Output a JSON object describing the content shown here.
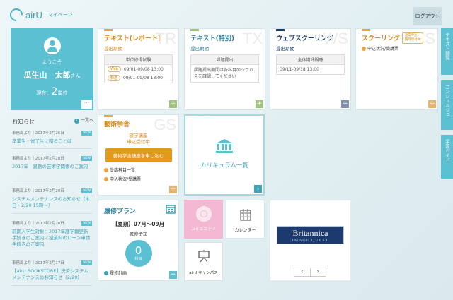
{
  "header": {
    "logo_text": "airU",
    "logo_sub": "マイページ",
    "logout": "ログアウト"
  },
  "profile": {
    "welcome": "ようこそ",
    "name": "瓜生山　太郎",
    "honorific": "さん",
    "credits_prefix": "現在：",
    "credits_value": "2",
    "credits_unit": "単位",
    "more": "···"
  },
  "news": {
    "heading": "お知らせ",
    "all_link": "一覧へ",
    "new_badge": "NEW",
    "items": [
      {
        "meta": "事務局より｜2017年2月25日",
        "title": "卒業生・修了生に贈ることば"
      },
      {
        "meta": "事務局より｜2017年2月20日",
        "title": "2017年　異動の芸術学関係のご案内"
      },
      {
        "meta": "事務局より｜2017年2月20日",
        "title": "システムメンテナンスのお知らせ（木日・2/20 15時～）"
      },
      {
        "meta": "事務局より｜2017年2月20日",
        "title": "前期入学生対象：2017年度学籍更新手続きのご案内／授業料のローン申請手続きのご案内"
      },
      {
        "meta": "事務局より｜2017年2月17日",
        "title": "【airU BOOKSTORE】決済システムメンテナンスのお知らせ（2/20）"
      }
    ]
  },
  "tiles": {
    "text_report": {
      "title": "テキスト(レポート)",
      "bg": "TR",
      "period_label": "提出期間",
      "box_header": "単位修得試験",
      "rows": [
        {
          "tag": "Web",
          "dates": "09/01-09/08 13:00"
        },
        {
          "tag": "郵送",
          "dates": "09/01-09/08 13:00"
        }
      ]
    },
    "text_special": {
      "title": "テキスト(特別)",
      "bg": "TX",
      "period_label": "提出期間",
      "box_header": "課題提出",
      "box_body": "課題提出期間は各科目のシラバスを確認してください"
    },
    "web_schooling": {
      "title": "ウェブスクーリング",
      "bg": "WS",
      "period_label": "提出期間",
      "box_header": "全体講評視聴",
      "box_body": "09/11-09/18 13:00"
    },
    "schooling": {
      "title": "スクーリング",
      "bg": "S",
      "stamp": "通常申込・随時受付中",
      "link": "申込状況/受講票"
    },
    "art": {
      "title": "藝術学舎",
      "bg": "GS",
      "notice_line1": "旅学講座",
      "notice_line2": "申込受付中",
      "button": "藝術学舎講座を申し込む",
      "link1": "受講科目一覧",
      "link2": "申込状況/受講票"
    },
    "curriculum": {
      "label": "カリキュラム一覧"
    },
    "plan": {
      "title": "履修プラン",
      "period": "【夏期】07月～09月",
      "status": "履修予定",
      "count": "0",
      "count_unit": "科目",
      "link": "履修計画"
    },
    "community": {
      "label": "コミュニティ"
    },
    "calendar": {
      "label": "カレンダー"
    },
    "campus": {
      "label": "airU キャンパス"
    },
    "britannica": {
      "line1": "Britannica",
      "line2": "IMAGE QUEST"
    },
    "carousel": {
      "prev": "‹",
      "next": "›"
    }
  },
  "side_tabs": [
    {
      "label": "テキスト閲覧"
    },
    {
      "label": "コンシェルジュ"
    },
    {
      "label": "学習ガイド"
    }
  ],
  "colors": {
    "accent": "#5bc0d1",
    "orange": "#e29a1d",
    "navy": "#1b3d6b"
  }
}
